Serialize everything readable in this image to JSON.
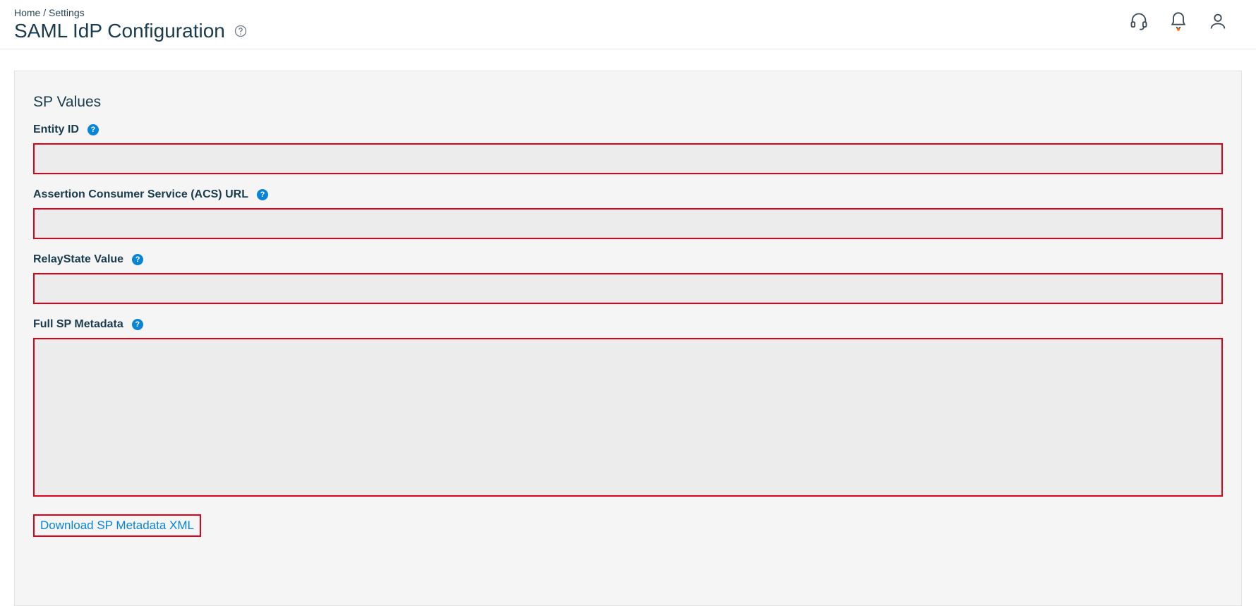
{
  "breadcrumb": {
    "home": "Home",
    "sep": "/",
    "settings": "Settings"
  },
  "pageTitle": "SAML IdP Configuration",
  "section": {
    "title": "SP Values",
    "entityId": {
      "label": "Entity ID",
      "value": ""
    },
    "acsUrl": {
      "label": "Assertion Consumer Service (ACS) URL",
      "value": ""
    },
    "relayState": {
      "label": "RelayState Value",
      "value": ""
    },
    "fullMeta": {
      "label": "Full SP Metadata",
      "value": ""
    },
    "downloadLink": "Download SP Metadata XML"
  },
  "icons": {
    "pageHelp": "help-circle-icon",
    "fieldHelp": "question-mark-icon",
    "headset": "headset-icon",
    "bell": "bell-icon",
    "user": "user-icon"
  }
}
